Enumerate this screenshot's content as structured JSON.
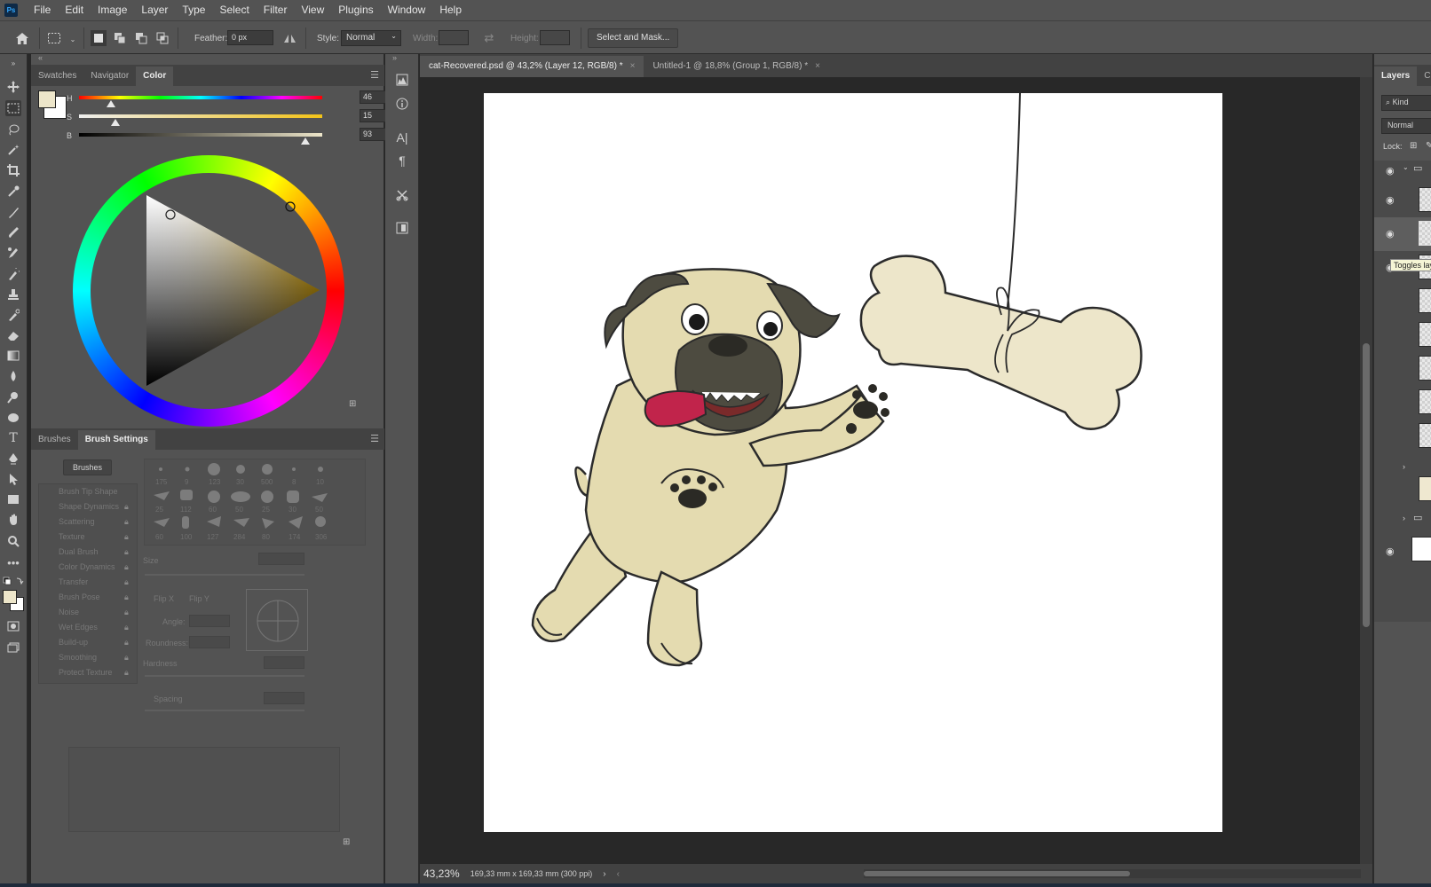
{
  "app": {
    "logo": "Ps",
    "menu": [
      "File",
      "Edit",
      "Image",
      "Layer",
      "Type",
      "Select",
      "Filter",
      "View",
      "Plugins",
      "Window",
      "Help"
    ]
  },
  "options": {
    "feather_label": "Feather:",
    "feather_value": "0 px",
    "style_label": "Style:",
    "style_value": "Normal",
    "width_label": "Width:",
    "height_label": "Height:",
    "select_mask": "Select and Mask..."
  },
  "color_panel": {
    "tabs": [
      "Swatches",
      "Navigator",
      "Color"
    ],
    "active_tab": "Color",
    "h_label": "H",
    "s_label": "S",
    "b_label": "B",
    "h_value": "46",
    "s_value": "15",
    "b_value": "93",
    "h_unit": "°",
    "s_unit": "%",
    "b_unit": "%",
    "h_fraction": 0.13,
    "s_fraction": 0.15,
    "b_fraction": 0.93,
    "foreground": "#EDE6CA",
    "background": "#FFFFFF"
  },
  "brush_panel": {
    "tabs": [
      "Brushes",
      "Brush Settings"
    ],
    "active_tab": "Brush Settings",
    "brushes_button": "Brushes",
    "settings": [
      "Brush Tip Shape",
      "Shape Dynamics",
      "Scattering",
      "Texture",
      "Dual Brush",
      "Color Dynamics",
      "Transfer",
      "Brush Pose",
      "Noise",
      "Wet Edges",
      "Build-up",
      "Smoothing",
      "Protect Texture"
    ],
    "brush_sizes_row1": [
      "175",
      "9",
      "123",
      "30",
      "500",
      "8",
      "10"
    ],
    "brush_sizes_row2": [
      "25",
      "112",
      "60",
      "50",
      "25",
      "30",
      "50"
    ],
    "brush_sizes_row3": [
      "60",
      "100",
      "127",
      "284",
      "80",
      "174",
      "306"
    ],
    "size_label": "Size",
    "flip_x": "Flip X",
    "flip_y": "Flip Y",
    "angle_label": "Angle:",
    "roundness_label": "Roundness:",
    "hardness_label": "Hardness",
    "spacing_label": "Spacing"
  },
  "document": {
    "tabs": [
      {
        "label": "cat-Recovered.psd @ 43,2% (Layer 12, RGB/8) *",
        "close": "×"
      },
      {
        "label": "Untitled-1 @ 18,8% (Group 1, RGB/8) *",
        "close": "×"
      }
    ],
    "zoom": "43,23%",
    "doc_info": "169,33 mm x 169,33 mm (300 ppi)",
    "nav_next": "›",
    "nav_prev": "‹"
  },
  "layers_panel": {
    "tabs": [
      "Layers",
      "Cha"
    ],
    "search_placeholder": "Kind",
    "blend_mode": "Normal",
    "lock_label": "Lock:",
    "tooltip": "Toggles lay"
  },
  "colors": {
    "ui_bg": "#535353",
    "ui_dark": "#424242",
    "pug_body": "#E4DBB0",
    "pug_dark": "#4D4B40",
    "tongue": "#C1244B",
    "bone": "#EDE6CA"
  }
}
